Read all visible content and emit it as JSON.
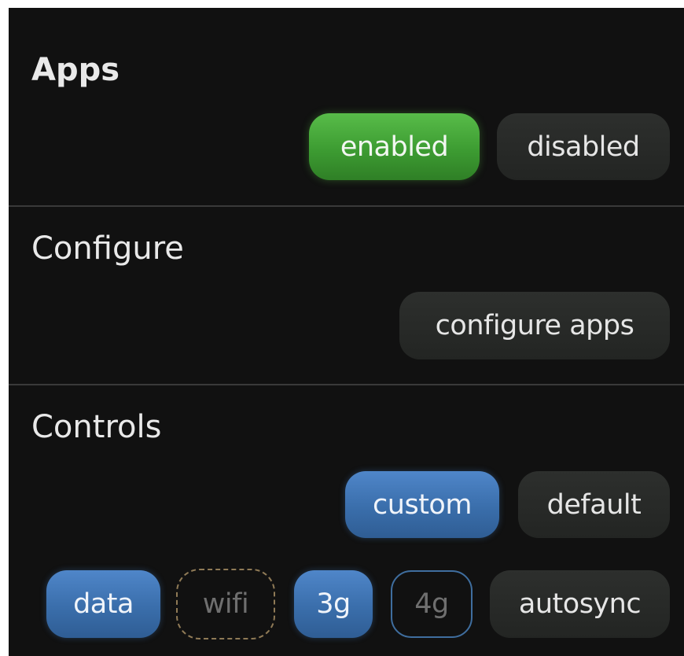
{
  "sections": {
    "apps": {
      "title": "Apps",
      "enabled_label": "enabled",
      "disabled_label": "disabled",
      "selected": "enabled"
    },
    "configure": {
      "title": "Configure",
      "configure_apps_label": "configure apps"
    },
    "controls": {
      "title": "Controls",
      "custom_label": "custom",
      "default_label": "default",
      "selected": "custom",
      "toggles": {
        "data": {
          "label": "data",
          "state": "on"
        },
        "wifi": {
          "label": "wifi",
          "state": "off"
        },
        "threeg": {
          "label": "3g",
          "state": "on"
        },
        "fourg": {
          "label": "4g",
          "state": "off"
        },
        "autosync": {
          "label": "autosync",
          "state": "neutral"
        }
      }
    }
  },
  "colors": {
    "background": "#111111",
    "enabled_green": "#4aad3d",
    "selected_blue": "#3f75b5",
    "pill_gray": "#2a2c2a",
    "divider": "#3a3a3a",
    "text": "#e9e9e9",
    "inactive_text": "#6f6f6f",
    "wifi_dashed_border": "#8f7a56"
  }
}
